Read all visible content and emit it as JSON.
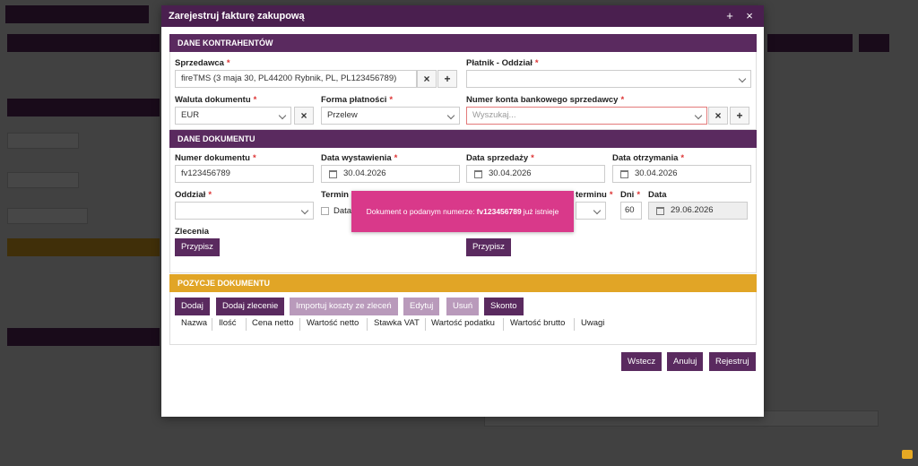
{
  "modal": {
    "title": "Zarejestruj fakturę zakupową",
    "plus_icon": "+",
    "close_icon": "×"
  },
  "contractors": {
    "header": "DANE KONTRAHENTÓW",
    "seller_label": "Sprzedawca",
    "seller_value": "fireTMS (3 maja 30, PL44200 Rybnik, PL, PL123456789)",
    "payer_label": "Płatnik - Oddział",
    "payer_value": "",
    "currency_label": "Waluta dokumentu",
    "currency_value": "EUR",
    "payment_label": "Forma płatności",
    "payment_value": "Przelew",
    "account_label": "Numer konta bankowego sprzedawcy",
    "account_placeholder": "Wyszukaj..."
  },
  "document": {
    "header": "DANE DOKUMENTU",
    "number_label": "Numer dokumentu",
    "number_value": "fv123456789",
    "issue_label": "Data wystawienia",
    "issue_value": "30.04.2026",
    "sale_label": "Data sprzedaży",
    "sale_value": "30.04.2026",
    "receipt_label": "Data otrzymania",
    "receipt_value": "30.04.2026",
    "branch_label": "Oddział",
    "branch_value": "",
    "term_label": "Termin p",
    "term_check_label": "Data",
    "term_right_label": "terminu",
    "days_label": "Dni",
    "days_value": "60",
    "date_label": "Data",
    "date_value": "29.06.2026",
    "orders_label": "Zlecenia",
    "assign_left": "Przypisz",
    "assign_right": "Przypisz"
  },
  "positions": {
    "header": "POZYCJE DOKUMENTU",
    "buttons": [
      "Dodaj",
      "Dodaj zlecenie",
      "Importuj koszty ze zleceń",
      "Edytuj",
      "Usuń",
      "Skonto"
    ],
    "columns": [
      "Nazwa",
      "Ilość",
      "Cena netto",
      "Wartość netto",
      "Stawka VAT",
      "Wartość podatku",
      "Wartość brutto",
      "Uwagi"
    ]
  },
  "footer": {
    "back": "Wstecz",
    "cancel": "Anuluj",
    "register": "Rejestruj"
  },
  "toast": {
    "prefix": "Dokument o podanym numerze:",
    "number": "fv123456789",
    "suffix": "już istnieje"
  },
  "colors": {
    "header": "#4a1f4f",
    "section": "#5a2a5f",
    "gold": "#e1a526",
    "toast": "#d9398a"
  }
}
